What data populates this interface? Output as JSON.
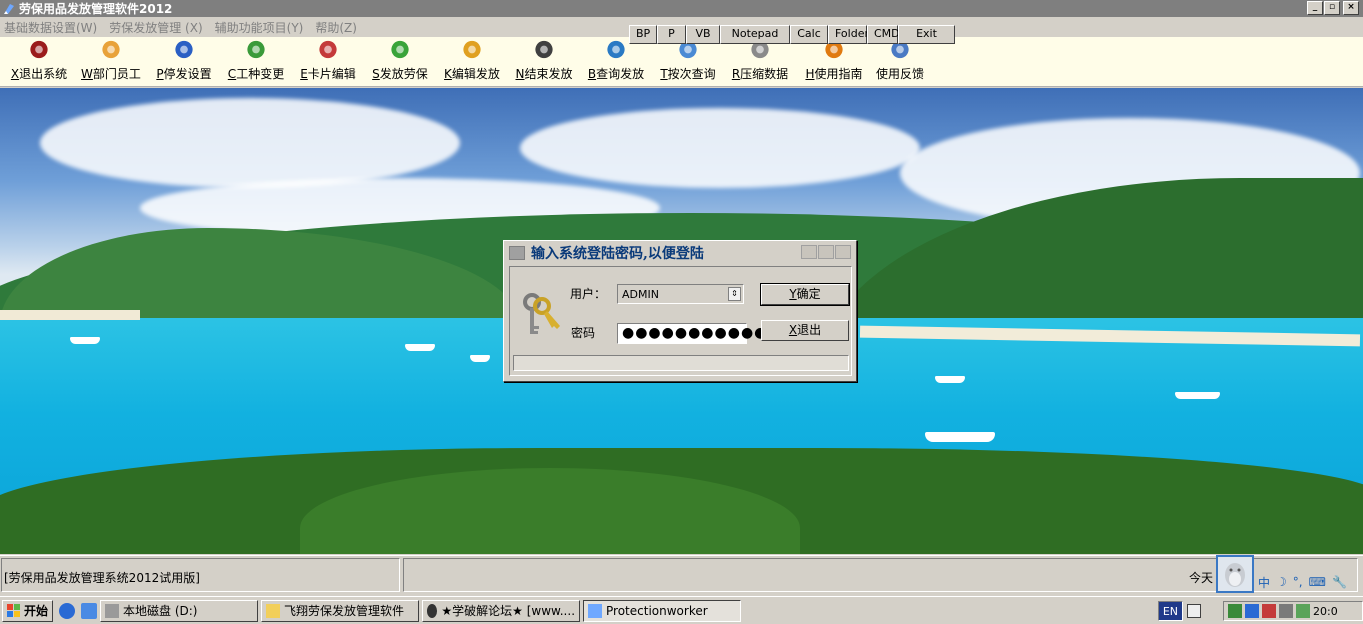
{
  "window": {
    "title": "劳保用品发放管理软件2012",
    "minimize_label": "_",
    "restore_label": "▫",
    "close_label": "×"
  },
  "menu": [
    "基础数据设置(W)",
    "劳保发放管理 (X)",
    "辅助功能项目(Y)",
    "帮助(Z)"
  ],
  "quickbar": [
    "BP",
    "P",
    "VB",
    "Notepad",
    "Calc",
    "Folder",
    "CMD",
    "Exit"
  ],
  "toolbar": [
    {
      "key": "X",
      "label": "退出系统",
      "icon": "exit-door-icon",
      "color": "#9b1c1c"
    },
    {
      "key": "W",
      "label": "部门员工",
      "icon": "user-icon",
      "color": "#e8a23a"
    },
    {
      "key": "P",
      "label": "停发设置",
      "icon": "info-icon",
      "color": "#2a5fc4"
    },
    {
      "key": "C",
      "label": "工种变更",
      "icon": "users-icon",
      "color": "#3a9a3a"
    },
    {
      "key": "E",
      "label": "卡片编辑",
      "icon": "group-icon",
      "color": "#c43a3a"
    },
    {
      "key": "S",
      "label": "发放劳保",
      "icon": "user-add-icon",
      "color": "#3aa43a"
    },
    {
      "key": "K",
      "label": "编辑发放",
      "icon": "pencil-icon",
      "color": "#e0a020"
    },
    {
      "key": "N",
      "label": "结束发放",
      "icon": "floppy-icon",
      "color": "#404040"
    },
    {
      "key": "B",
      "label": "查询发放",
      "icon": "magnifier-icon",
      "color": "#2a7ac4"
    },
    {
      "key": "T",
      "label": "按次查询",
      "icon": "search-icon",
      "color": "#4a8ad4"
    },
    {
      "key": "R",
      "label": "压缩数据",
      "icon": "database-icon",
      "color": "#8a8a8a"
    },
    {
      "key": "H",
      "label": "使用指南",
      "icon": "help-icon",
      "color": "#e07a10"
    },
    {
      "key": "",
      "label": "使用反馈",
      "icon": "mail-icon",
      "color": "#4a7ac4"
    }
  ],
  "dialog": {
    "title": "输入系统登陆密码,以便登陆",
    "user_label": "用户：",
    "user_value": "ADMIN",
    "password_label": "密码",
    "password_value": "●●●●●●●●●●●",
    "ok_key": "Y",
    "ok_label": "确定",
    "exit_key": "X",
    "exit_label": "退出"
  },
  "status": {
    "left_text": "[劳保用品发放管理系统2012试用版]",
    "right_text": "今天"
  },
  "ime": [
    "中",
    "☽",
    "°,",
    "⌨",
    "🔧"
  ],
  "taskbar": {
    "start_label": "开始",
    "tasks": [
      {
        "label": "本地磁盘 (D:)",
        "icon": "drive-icon",
        "active": false
      },
      {
        "label": "飞翔劳保发放管理软件",
        "icon": "folder-icon",
        "active": false
      },
      {
        "label": "★学破解论坛★ [www....",
        "icon": "browser-icon",
        "active": false
      },
      {
        "label": "Protectionworker",
        "icon": "app-icon",
        "active": true
      }
    ],
    "language": "EN",
    "clock": "20:0"
  }
}
